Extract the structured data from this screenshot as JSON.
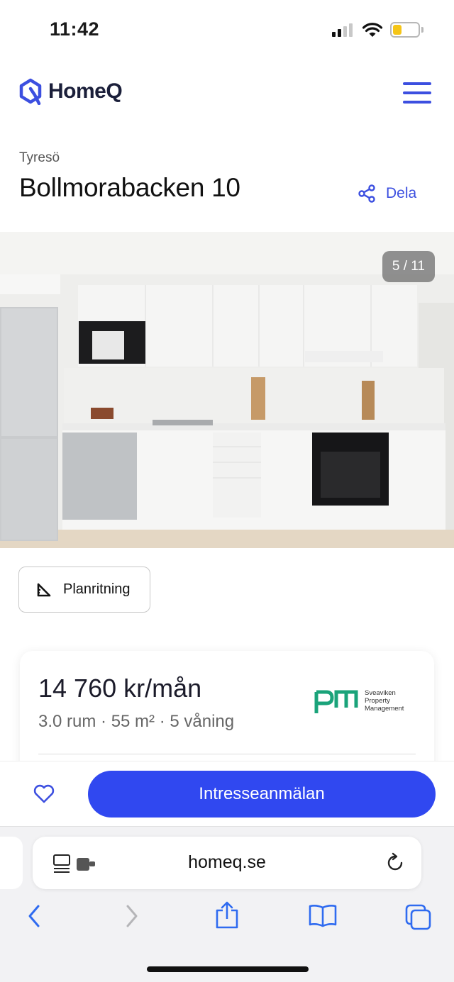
{
  "status_bar": {
    "time": "11:42"
  },
  "header": {
    "brand": "HomeQ"
  },
  "listing": {
    "city": "Tyresö",
    "address": "Bollmorabacken 10",
    "share_label": "Dela",
    "photo_counter": "5 / 11",
    "floorplan_label": "Planritning",
    "price": "14 760 kr/mån",
    "specs": "3.0 rum · 55 m² · 5 våning",
    "landlord": {
      "line1": "Sveaviken",
      "line2": "Property",
      "line3": "Management"
    }
  },
  "actions": {
    "interest_label": "Intresseanmälan"
  },
  "browser": {
    "url": "homeq.se"
  },
  "colors": {
    "accent": "#3c4fe0",
    "cta": "#3048f0",
    "pm_green": "#1aa37a"
  },
  "icons": [
    "logo-icon",
    "menu-icon",
    "share-icon",
    "floorplan-icon",
    "heart-icon",
    "reader-icon",
    "reload-icon",
    "back-icon",
    "forward-icon",
    "share-sheet-icon",
    "bookmarks-icon",
    "tabs-icon"
  ]
}
